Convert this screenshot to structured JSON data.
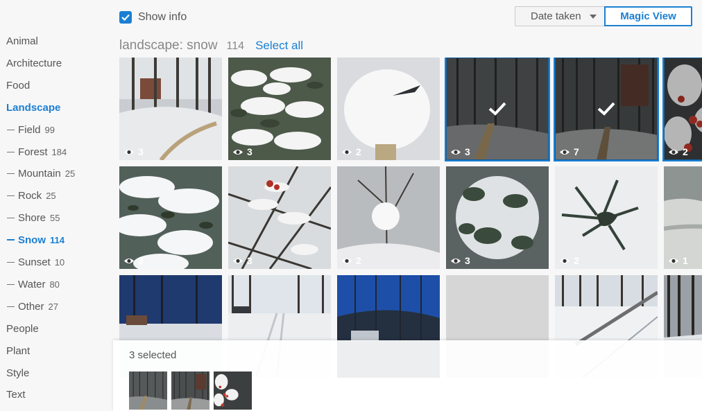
{
  "header": {
    "show_info_label": "Show info",
    "date_button_label": "Date taken",
    "magic_button_label": "Magic View",
    "title": "landscape: snow",
    "count": "114",
    "select_all_label": "Select all"
  },
  "sidebar": {
    "items": [
      {
        "label": "Animal",
        "count": "",
        "sub": false,
        "active": false
      },
      {
        "label": "Architecture",
        "count": "",
        "sub": false,
        "active": false
      },
      {
        "label": "Food",
        "count": "",
        "sub": false,
        "active": false
      },
      {
        "label": "Landscape",
        "count": "",
        "sub": false,
        "active": true
      },
      {
        "label": "Field",
        "count": "99",
        "sub": true,
        "active": false
      },
      {
        "label": "Forest",
        "count": "184",
        "sub": true,
        "active": false
      },
      {
        "label": "Mountain",
        "count": "25",
        "sub": true,
        "active": false
      },
      {
        "label": "Rock",
        "count": "25",
        "sub": true,
        "active": false
      },
      {
        "label": "Shore",
        "count": "55",
        "sub": true,
        "active": false
      },
      {
        "label": "Snow",
        "count": "114",
        "sub": true,
        "active": true
      },
      {
        "label": "Sunset",
        "count": "10",
        "sub": true,
        "active": false
      },
      {
        "label": "Water",
        "count": "80",
        "sub": true,
        "active": false
      },
      {
        "label": "Other",
        "count": "27",
        "sub": true,
        "active": false
      },
      {
        "label": "People",
        "count": "",
        "sub": false,
        "active": false
      },
      {
        "label": "Plant",
        "count": "",
        "sub": false,
        "active": false
      },
      {
        "label": "Style",
        "count": "",
        "sub": false,
        "active": false
      },
      {
        "label": "Text",
        "count": "",
        "sub": false,
        "active": false
      }
    ]
  },
  "photos": [
    {
      "views": "3",
      "selected": false,
      "scene": "house-trees"
    },
    {
      "views": "3",
      "selected": false,
      "scene": "leaves-snow"
    },
    {
      "views": "2",
      "selected": false,
      "scene": "snow-mound"
    },
    {
      "views": "3",
      "selected": true,
      "scene": "dark-stairs"
    },
    {
      "views": "7",
      "selected": true,
      "scene": "dark-path"
    },
    {
      "views": "2",
      "selected": true,
      "scene": "red-berries"
    },
    {
      "views": "3",
      "selected": false,
      "scene": "branches-heavy"
    },
    {
      "views": "3",
      "selected": false,
      "scene": "twigs-berries"
    },
    {
      "views": "2",
      "selected": false,
      "scene": "snowball-twig"
    },
    {
      "views": "3",
      "selected": false,
      "scene": "shrub-snow"
    },
    {
      "views": "2",
      "selected": false,
      "scene": "pine-needles"
    },
    {
      "views": "1",
      "selected": false,
      "scene": "grey-snow"
    },
    {
      "views": "",
      "selected": false,
      "scene": "street-dusk"
    },
    {
      "views": "",
      "selected": false,
      "scene": "road-snow"
    },
    {
      "views": "",
      "selected": false,
      "scene": "blue-sky-trees"
    },
    {
      "views": "",
      "selected": false,
      "scene": "placeholder"
    },
    {
      "views": "",
      "selected": false,
      "scene": "railing"
    },
    {
      "views": "",
      "selected": false,
      "scene": "forest-edge"
    }
  ],
  "selection": {
    "label": "3 selected"
  },
  "colors": {
    "accent": "#1a7fd3"
  }
}
